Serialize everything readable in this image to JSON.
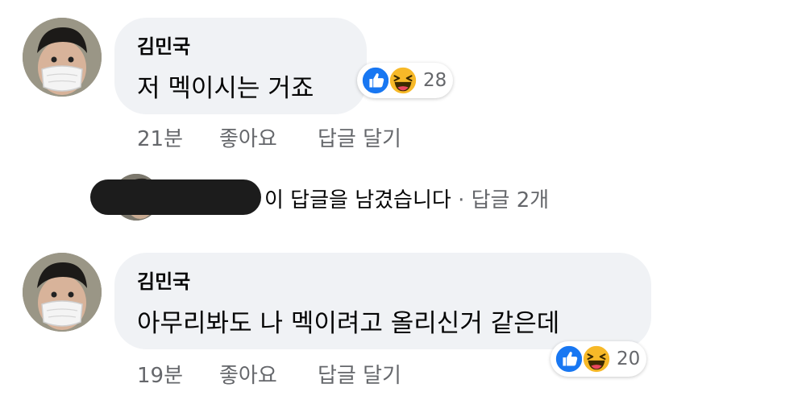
{
  "comments": [
    {
      "author": "김민국",
      "text": "저 멕이시는 거죠",
      "time": "21분",
      "like_label": "좋아요",
      "reply_label": "답글 달기",
      "reactions": {
        "icons": [
          "like-icon",
          "haha-icon"
        ],
        "count": "28"
      }
    },
    {
      "author": "김민국",
      "text": "아무리봐도 나 멕이려고 올리신거 같은데",
      "time": "19분",
      "like_label": "좋아요",
      "reply_label": "답글 달기",
      "reactions": {
        "icons": [
          "like-icon",
          "haha-icon"
        ],
        "count": "20"
      }
    }
  ],
  "reply_summary": {
    "text": "이 답글을 남겼습니다",
    "separator": "·",
    "count_text": "답글 2개"
  },
  "colors": {
    "bubble": "#f0f2f5",
    "like_blue": "#1877f2",
    "haha_yellow": "#f7b928",
    "meta_gray": "#65676b"
  }
}
